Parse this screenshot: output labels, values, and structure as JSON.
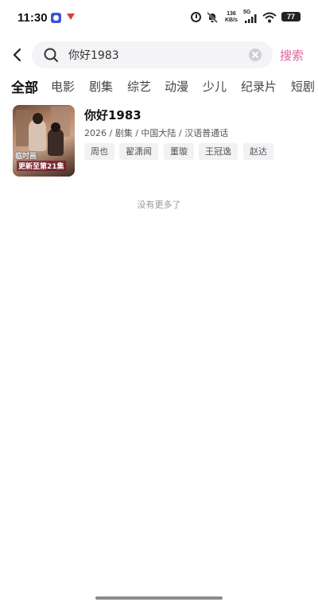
{
  "status_bar": {
    "time": "11:30",
    "network_speed_value": "136",
    "network_speed_unit": "KB/s",
    "signal_label": "5G",
    "battery": "77"
  },
  "search": {
    "query": "你好1983",
    "submit_label": "搜索",
    "accent_color": "#e4609a"
  },
  "tabs": [
    "全部",
    "电影",
    "剧集",
    "综艺",
    "动漫",
    "少儿",
    "纪录片",
    "短剧"
  ],
  "results": [
    {
      "title": "你好1983",
      "meta": "2026 / 剧集 / 中国大陆 / 汉语普通话",
      "poster_caption_top": "临时画",
      "poster_caption_bottom": "更新至第21集",
      "cast": [
        "周也",
        "翟潇闻",
        "董璇",
        "王冠逸",
        "赵达"
      ]
    }
  ],
  "footer": {
    "no_more": "没有更多了"
  }
}
